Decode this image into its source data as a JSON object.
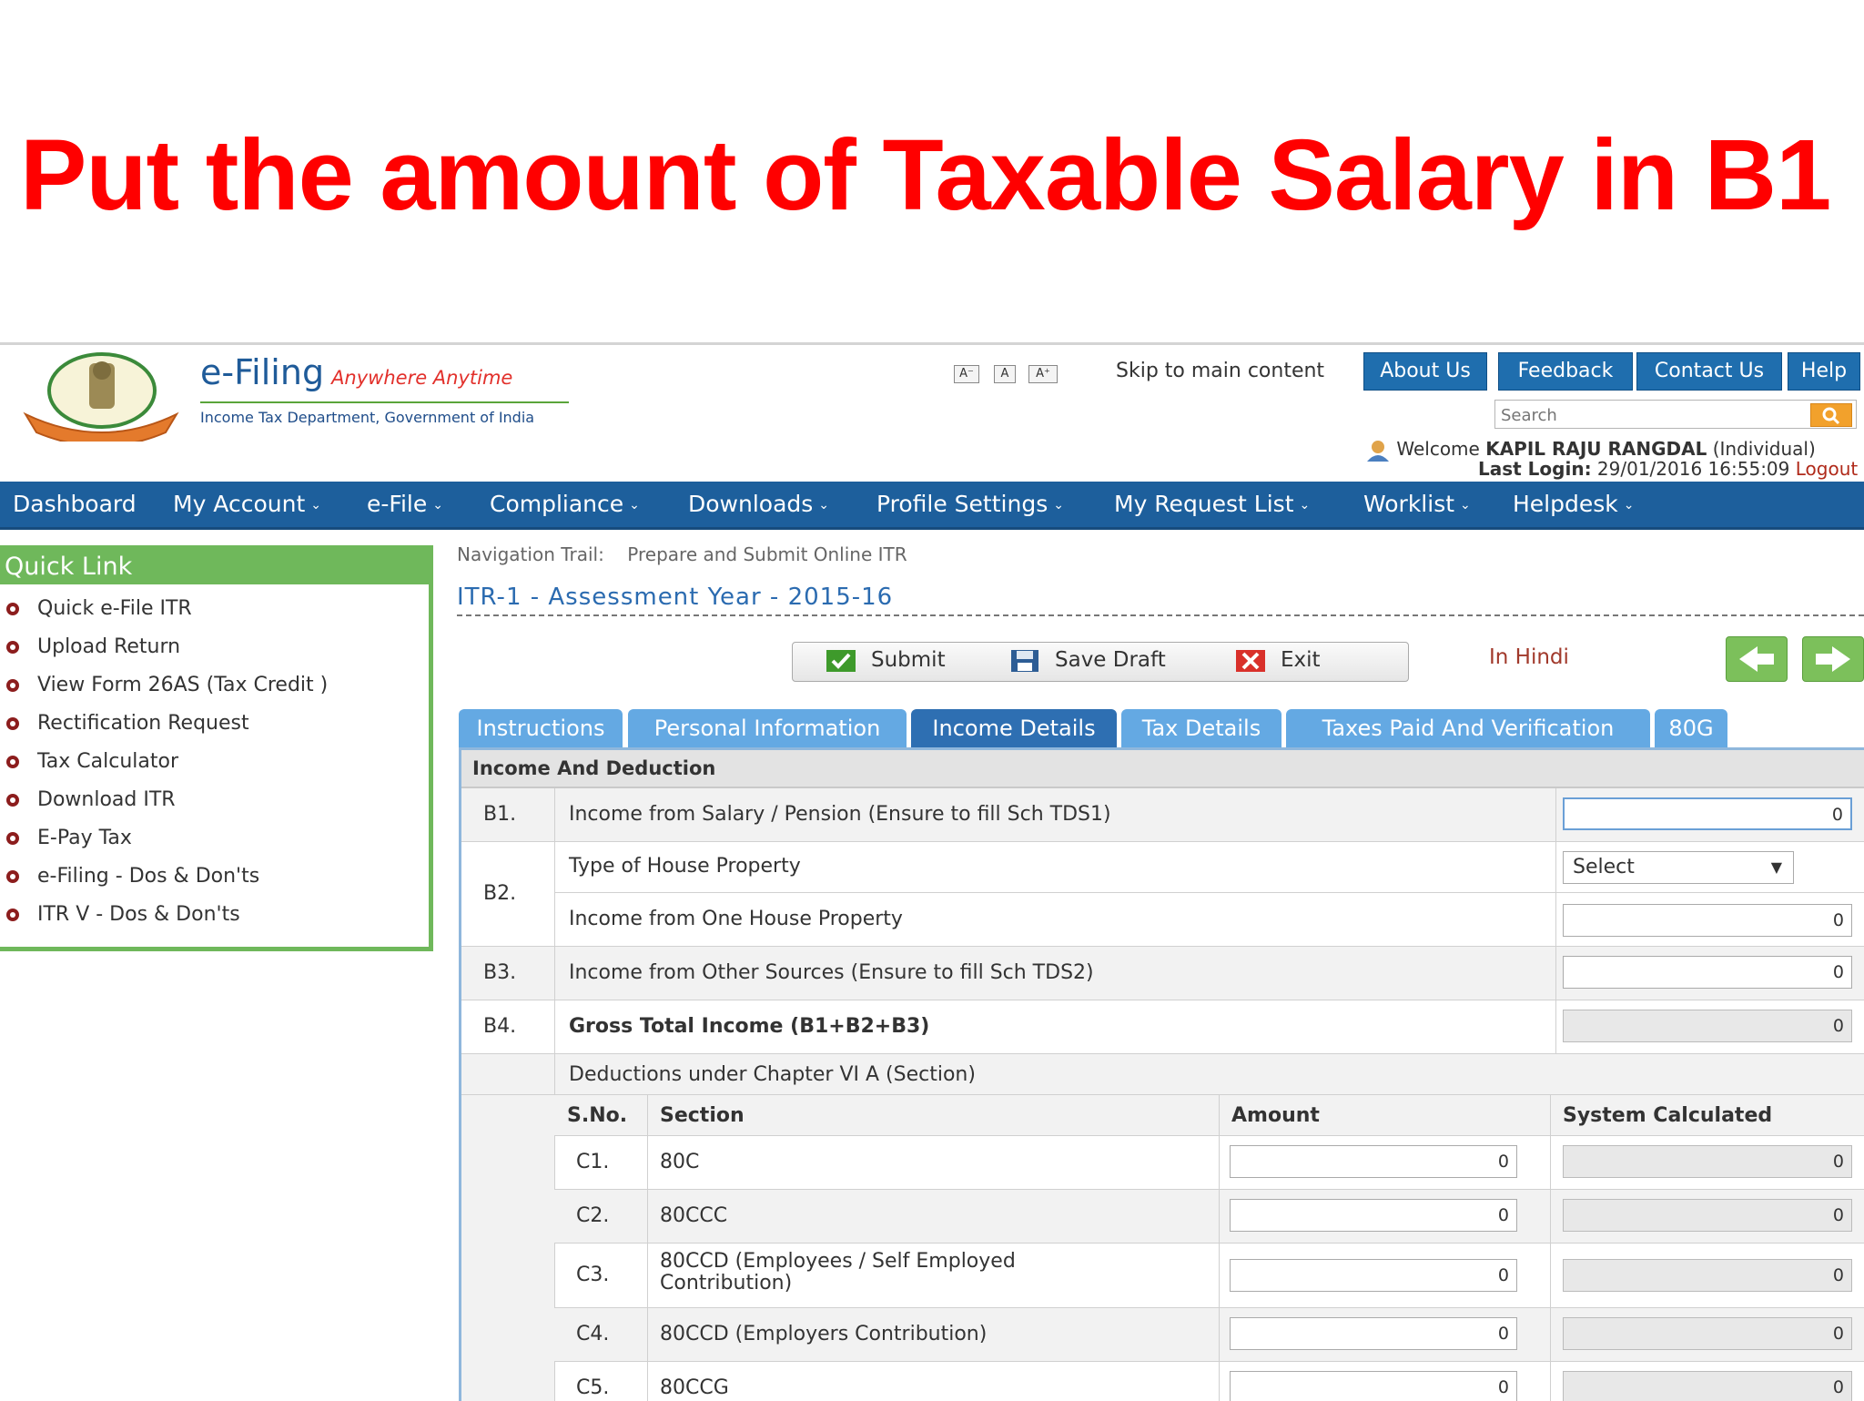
{
  "slide_title": "Put the amount of Taxable Salary in B1",
  "header": {
    "brand": "e-Filing",
    "tagline": "Anywhere Anytime",
    "subtitle": "Income Tax Department, Government of India",
    "font_small": "A⁻",
    "font_normal": "A",
    "font_large": "A⁺",
    "skip_link": "Skip to main content",
    "about": "About Us",
    "feedback": "Feedback",
    "contact": "Contact Us",
    "help": "Help",
    "search_placeholder": "Search",
    "welcome_prefix": "Welcome",
    "user_name": "KAPIL RAJU RANGDAL",
    "user_type": "(Individual)",
    "last_login_label": "Last Login:",
    "last_login_value": "29/01/2016 16:55:09",
    "logout": "Logout"
  },
  "nav": [
    "Dashboard",
    "My Account",
    "e-File",
    "Compliance",
    "Downloads",
    "Profile Settings",
    "My Request List",
    "Worklist",
    "Helpdesk"
  ],
  "quick_link": {
    "title": "Quick Link",
    "items": [
      "Quick e-File ITR",
      "Upload Return",
      "View Form 26AS (Tax Credit )",
      "Rectification Request",
      "Tax Calculator",
      "Download ITR",
      "E-Pay Tax",
      "e-Filing - Dos & Don'ts",
      "ITR V - Dos & Don'ts"
    ]
  },
  "trail": {
    "label": "Navigation Trail:",
    "value": "Prepare and Submit Online ITR"
  },
  "form_title": "ITR-1 - Assessment Year - 2015-16",
  "actions": {
    "submit": "Submit",
    "save": "Save Draft",
    "exit": "Exit",
    "hindi": "In Hindi"
  },
  "tabs": [
    "Instructions",
    "Personal Information",
    "Income Details",
    "Tax Details",
    "Taxes Paid And Verification",
    "80G"
  ],
  "active_tab": "Income Details",
  "section_title": "Income And Deduction",
  "rows": {
    "b1": {
      "code": "B1.",
      "label": "Income from Salary / Pension (Ensure to fill Sch TDS1)",
      "value": "0"
    },
    "b2": {
      "code": "B2.",
      "type_label": "Type of House Property",
      "select_value": "Select",
      "income_label": "Income from One House Property",
      "value": "0"
    },
    "b3": {
      "code": "B3.",
      "label": "Income from Other Sources (Ensure to fill Sch TDS2)",
      "value": "0"
    },
    "b4": {
      "code": "B4.",
      "label": "Gross Total Income (B1+B2+B3)",
      "value": "0"
    },
    "deductions_label": "Deductions under Chapter VI A (Section)"
  },
  "ded_headers": {
    "sno": "S.No.",
    "section": "Section",
    "amount": "Amount",
    "system": "System Calculated"
  },
  "deductions": [
    {
      "sno": "C1.",
      "section": "80C",
      "amount": "0",
      "system": "0"
    },
    {
      "sno": "C2.",
      "section": "80CCC",
      "amount": "0",
      "system": "0"
    },
    {
      "sno": "C3.",
      "section": "80CCD (Employees / Self Employed",
      "section2": "Contribution)",
      "amount": "0",
      "system": "0"
    },
    {
      "sno": "C4.",
      "section": "80CCD (Employers Contribution)",
      "amount": "0",
      "system": "0"
    },
    {
      "sno": "C5.",
      "section": "80CCG",
      "amount": "0",
      "system": "0"
    }
  ],
  "colors": {
    "title_red": "#ff0000",
    "nav_blue": "#1d5f9c",
    "tab_blue": "#64a9e3",
    "tab_active": "#2e6fb2",
    "quick_green": "#6fb85b"
  }
}
